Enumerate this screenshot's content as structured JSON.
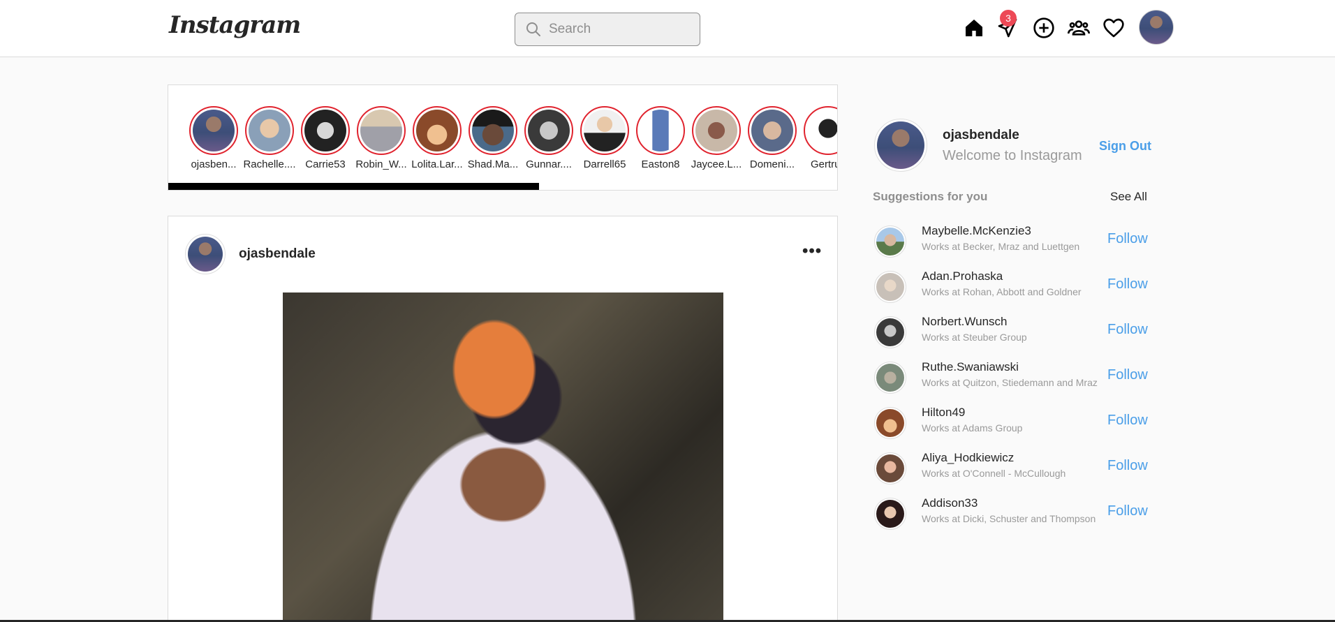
{
  "header": {
    "logo": "Instagram",
    "search_placeholder": "Search",
    "messages_badge": "3"
  },
  "stories": [
    {
      "name": "ojasben...",
      "color": "#4a5a8a"
    },
    {
      "name": "Rachelle....",
      "color": "#8aa0b8"
    },
    {
      "name": "Carrie53",
      "color": "#444444"
    },
    {
      "name": "Robin_W...",
      "color": "#b8a890"
    },
    {
      "name": "Lolita.Lar...",
      "color": "#c87a4a"
    },
    {
      "name": "Shad.Ma...",
      "color": "#3a3a3a"
    },
    {
      "name": "Gunnar....",
      "color": "#9a9a9a"
    },
    {
      "name": "Darrell65",
      "color": "#e8e8e8"
    },
    {
      "name": "Easton8",
      "color": "#5a7ab8"
    },
    {
      "name": "Jaycee.L...",
      "color": "#7a5a4a"
    },
    {
      "name": "Domeni...",
      "color": "#5a6a8a"
    },
    {
      "name": "Gertruc",
      "color": "#ffffff"
    }
  ],
  "post": {
    "username": "ojasbendale",
    "more": "•••"
  },
  "sidebar": {
    "username": "ojasbendale",
    "welcome": "Welcome to Instagram",
    "sign_out": "Sign Out",
    "suggestions_title": "Suggestions for you",
    "see_all": "See All",
    "suggestions": [
      {
        "name": "Maybelle.McKenzie3",
        "sub": "Works at Becker, Mraz and Luettgen",
        "follow": "Follow",
        "color": "#7a8a6a"
      },
      {
        "name": "Adan.Prohaska",
        "sub": "Works at Rohan, Abbott and Goldner",
        "follow": "Follow",
        "color": "#c8c0b8"
      },
      {
        "name": "Norbert.Wunsch",
        "sub": "Works at Steuber Group",
        "follow": "Follow",
        "color": "#5a5a5a"
      },
      {
        "name": "Ruthe.Swaniawski",
        "sub": "Works at Quitzon, Stiedemann and Mraz",
        "follow": "Follow",
        "color": "#8a8a7a"
      },
      {
        "name": "Hilton49",
        "sub": "Works at Adams Group",
        "follow": "Follow",
        "color": "#c87a4a"
      },
      {
        "name": "Aliya_Hodkiewicz",
        "sub": "Works at O'Connell - McCullough",
        "follow": "Follow",
        "color": "#9a6a5a"
      },
      {
        "name": "Addison33",
        "sub": "Works at Dicki, Schuster and Thompson",
        "follow": "Follow",
        "color": "#4a3a3a"
      }
    ]
  }
}
